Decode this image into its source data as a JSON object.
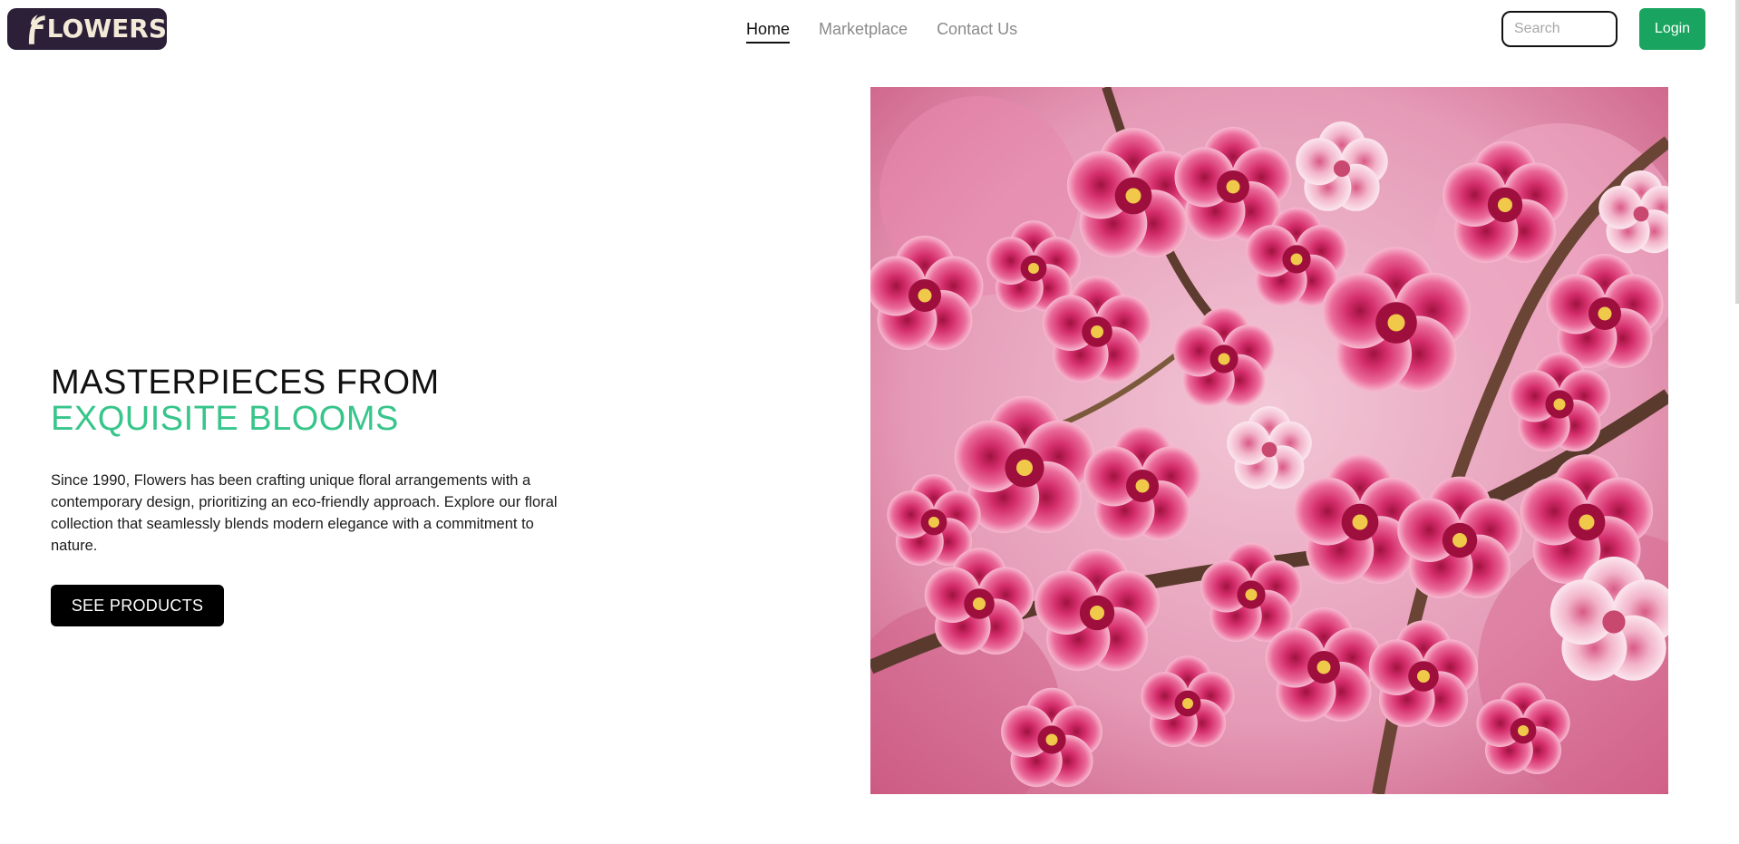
{
  "header": {
    "logo_text": "LOWERS",
    "nav": [
      {
        "label": "Home",
        "active": true
      },
      {
        "label": "Marketplace",
        "active": false
      },
      {
        "label": "Contact Us",
        "active": false
      }
    ],
    "search": {
      "placeholder": "Search",
      "value": ""
    },
    "login_label": "Login"
  },
  "hero": {
    "title_line1": "MASTERPIECES FROM",
    "title_line2": "EXQUISITE BLOOMS",
    "description": "Since 1990, Flowers has been crafting unique floral arrangements with a contemporary design, prioritizing an eco-friendly approach. Explore our floral collection that seamlessly blends modern elegance with a commitment to nature.",
    "cta_label": "SEE PRODUCTS"
  },
  "colors": {
    "logo_bg": "#2c1f38",
    "accent_green": "#36c58a",
    "login_bg": "#19a560",
    "cta_bg": "#000000"
  },
  "icons": {
    "logo_mark": "flower-f-icon",
    "hero_image": "cherry-blossom-photo"
  }
}
